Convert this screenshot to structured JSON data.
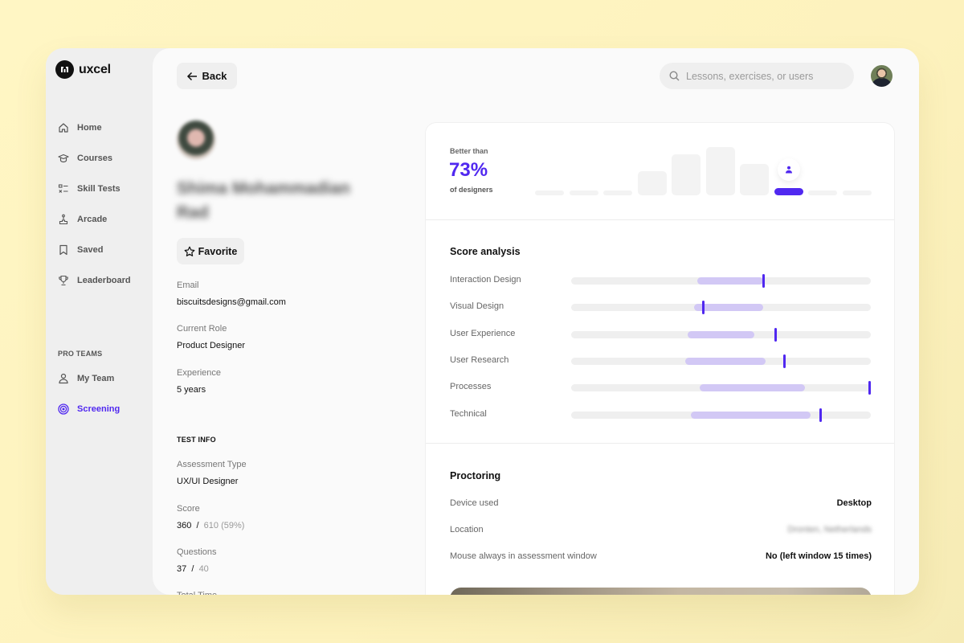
{
  "app": {
    "brand": "uxcel",
    "accent_color": "#5028f0"
  },
  "sidebar": {
    "items": [
      {
        "label": "Home",
        "icon": "home-icon"
      },
      {
        "label": "Courses",
        "icon": "graduation-cap-icon"
      },
      {
        "label": "Skill Tests",
        "icon": "checklist-icon"
      },
      {
        "label": "Arcade",
        "icon": "joystick-icon"
      },
      {
        "label": "Saved",
        "icon": "bookmark-icon"
      },
      {
        "label": "Leaderboard",
        "icon": "trophy-icon"
      }
    ],
    "section_label": "PRO TEAMS",
    "team_items": [
      {
        "label": "My Team",
        "icon": "user-icon",
        "active": false
      },
      {
        "label": "Screening",
        "icon": "target-icon",
        "active": true
      }
    ]
  },
  "header": {
    "back_label": "Back",
    "search_placeholder": "Lessons, exercises, or users"
  },
  "profile": {
    "name": "Shima Mohammadian Rad",
    "favorite_label": "Favorite",
    "fields": [
      {
        "label": "Email",
        "value": "biscuitsdesigns@gmail.com"
      },
      {
        "label": "Current Role",
        "value": "Product Designer"
      },
      {
        "label": "Experience",
        "value": "5 years"
      }
    ]
  },
  "test_info": {
    "heading": "TEST INFO",
    "assessment_type": {
      "label": "Assessment Type",
      "value": "UX/UI Designer"
    },
    "score": {
      "label": "Score",
      "value": "360",
      "sep": "/",
      "total": "610 (59%)"
    },
    "questions": {
      "label": "Questions",
      "value": "37",
      "sep": "/",
      "total": "40"
    },
    "total_time": {
      "label": "Total Time"
    }
  },
  "ranking": {
    "label": "Better than",
    "value": "73%",
    "sub": "of designers",
    "histogram_relative_heights": [
      0.07,
      0.07,
      0.07,
      0.5,
      0.85,
      1.0,
      0.65,
      0.13,
      0.07,
      0.07
    ],
    "user_bin_index": 7
  },
  "score_analysis": {
    "title": "Score analysis",
    "rows": [
      {
        "label": "Interaction Design",
        "range": [
          0.42,
          0.64
        ],
        "marker": 0.64
      },
      {
        "label": "Visual Design",
        "range": [
          0.41,
          0.64
        ],
        "marker": 0.44
      },
      {
        "label": "User Experience",
        "range": [
          0.39,
          0.61
        ],
        "marker": 0.68
      },
      {
        "label": "User Research",
        "range": [
          0.38,
          0.65
        ],
        "marker": 0.71
      },
      {
        "label": "Processes",
        "range": [
          0.43,
          0.78
        ],
        "marker": 1.0
      },
      {
        "label": "Technical",
        "range": [
          0.4,
          0.8
        ],
        "marker": 0.83
      }
    ]
  },
  "proctoring": {
    "title": "Proctoring",
    "rows": [
      {
        "label": "Device used",
        "value": "Desktop",
        "blurred": false
      },
      {
        "label": "Location",
        "value": "Dronten, Netherlands",
        "blurred": true
      },
      {
        "label": "Mouse always in assessment window",
        "value": "No (left window 15 times)",
        "blurred": false
      }
    ]
  }
}
